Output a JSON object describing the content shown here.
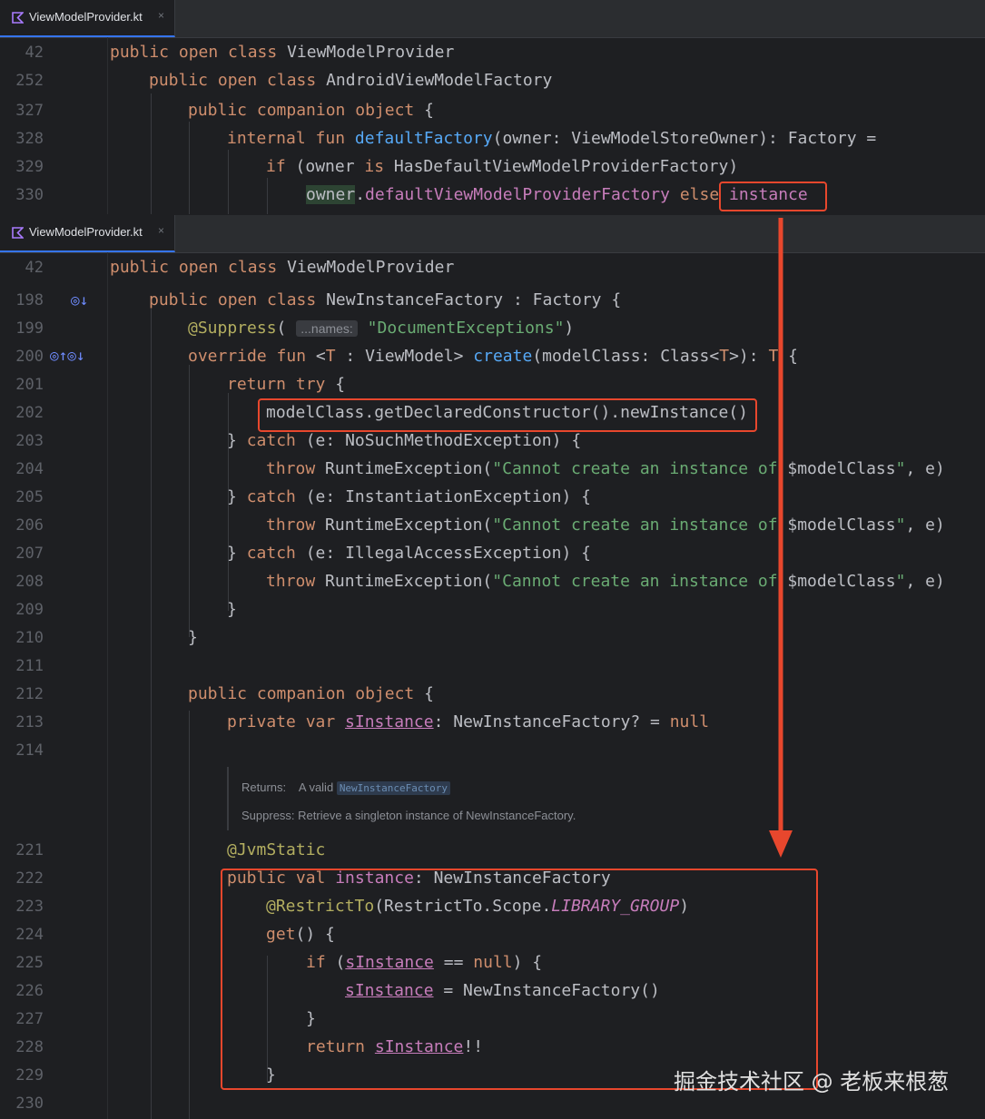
{
  "top_editor": {
    "tab_label": "ViewModelProvider.kt",
    "tab_close": "×",
    "lines": [
      {
        "num": "42",
        "text": "public open class ViewModelProvider"
      },
      {
        "num": "252",
        "text": "public open class AndroidViewModelFactory"
      },
      {
        "num": "327",
        "text": "public companion object {"
      },
      {
        "num": "328",
        "text": "internal fun defaultFactory(owner: ViewModelStoreOwner): Factory ="
      },
      {
        "num": "329",
        "text": "if (owner is HasDefaultViewModelProviderFactory)"
      },
      {
        "num": "330",
        "text": "owner.defaultViewModelProviderFactory else instance"
      }
    ]
  },
  "bottom_editor": {
    "tab_label": "ViewModelProvider.kt",
    "tab_close": "×",
    "line_numbers": [
      "42",
      "198",
      "199",
      "200",
      "201",
      "202",
      "203",
      "204",
      "205",
      "206",
      "207",
      "208",
      "209",
      "210",
      "211",
      "212",
      "213",
      "214",
      "221",
      "222",
      "223",
      "224",
      "225",
      "226",
      "227",
      "228",
      "229",
      "230"
    ],
    "names_hint": "...names:",
    "doc": {
      "returns_label": "Returns:",
      "returns_text": "A valid",
      "returns_code": "NewInstanceFactory",
      "suppress_label": "Suppress:",
      "suppress_text": "Retrieve a singleton instance of NewInstanceFactory."
    }
  },
  "watermark": "掘金技术社区 @ 老板来根葱",
  "colors": {
    "highlight": "#e8472d",
    "background": "#1e1f22",
    "keyword": "#cf8e6d",
    "string": "#6aab73"
  }
}
